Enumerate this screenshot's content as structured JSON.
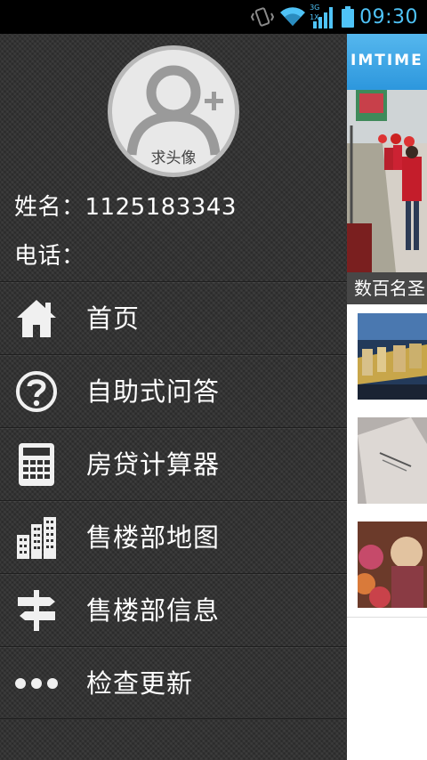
{
  "status_bar": {
    "time": "09:30",
    "network_badge_top": "3G",
    "network_badge_bottom": "1X",
    "accent_color": "#4fc3f7"
  },
  "drawer": {
    "avatar_caption": "求头像",
    "name_label": "姓名：",
    "name_value": "1125183343",
    "phone_label": "电话：",
    "phone_value": "",
    "menu": [
      {
        "label": "首页",
        "icon": "home-icon"
      },
      {
        "label": "自助式问答",
        "icon": "question-icon"
      },
      {
        "label": "房贷计算器",
        "icon": "calculator-icon"
      },
      {
        "label": "售楼部地图",
        "icon": "buildings-icon"
      },
      {
        "label": "售楼部信息",
        "icon": "signpost-icon"
      },
      {
        "label": "检查更新",
        "icon": "more-dots-icon"
      }
    ]
  },
  "content": {
    "brand": "IMTIME",
    "banner_caption": "数百名圣",
    "header_color": "#3aa6e6"
  }
}
